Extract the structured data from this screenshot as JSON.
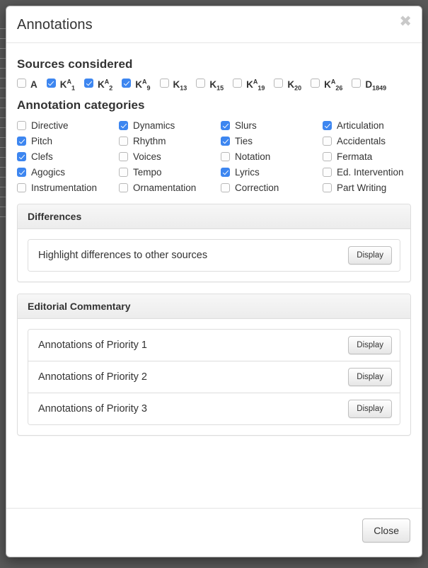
{
  "modal": {
    "title": "Annotations",
    "close_icon": "✖",
    "footer": {
      "close_label": "Close"
    }
  },
  "sources": {
    "heading": "Sources considered",
    "items": [
      {
        "base": "A",
        "sup": "",
        "sub": "",
        "checked": false
      },
      {
        "base": "K",
        "sup": "A",
        "sub": "1",
        "checked": true
      },
      {
        "base": "K",
        "sup": "A",
        "sub": "2",
        "checked": true
      },
      {
        "base": "K",
        "sup": "A",
        "sub": "9",
        "checked": true
      },
      {
        "base": "K",
        "sup": "",
        "sub": "13",
        "checked": false
      },
      {
        "base": "K",
        "sup": "",
        "sub": "15",
        "checked": false
      },
      {
        "base": "K",
        "sup": "A",
        "sub": "19",
        "checked": false
      },
      {
        "base": "K",
        "sup": "",
        "sub": "20",
        "checked": false
      },
      {
        "base": "K",
        "sup": "A",
        "sub": "26",
        "checked": false
      },
      {
        "base": "D",
        "sup": "",
        "sub": "1849",
        "checked": false
      }
    ]
  },
  "categories": {
    "heading": "Annotation categories",
    "items": [
      {
        "label": "Directive",
        "checked": false
      },
      {
        "label": "Dynamics",
        "checked": true
      },
      {
        "label": "Slurs",
        "checked": true
      },
      {
        "label": "Articulation",
        "checked": true
      },
      {
        "label": "Pitch",
        "checked": true
      },
      {
        "label": "Rhythm",
        "checked": false
      },
      {
        "label": "Ties",
        "checked": true
      },
      {
        "label": "Accidentals",
        "checked": false
      },
      {
        "label": "Clefs",
        "checked": true
      },
      {
        "label": "Voices",
        "checked": false
      },
      {
        "label": "Notation",
        "checked": false
      },
      {
        "label": "Fermata",
        "checked": false
      },
      {
        "label": "Agogics",
        "checked": true
      },
      {
        "label": "Tempo",
        "checked": false
      },
      {
        "label": "Lyrics",
        "checked": true
      },
      {
        "label": "Ed. Intervention",
        "checked": false
      },
      {
        "label": "Instrumentation",
        "checked": false
      },
      {
        "label": "Ornamentation",
        "checked": false
      },
      {
        "label": "Correction",
        "checked": false
      },
      {
        "label": "Part Writing",
        "checked": false
      }
    ]
  },
  "differences": {
    "heading": "Differences",
    "rows": [
      {
        "label": "Highlight differences to other sources",
        "button": "Display"
      }
    ]
  },
  "editorial": {
    "heading": "Editorial Commentary",
    "rows": [
      {
        "label": "Annotations of Priority 1",
        "button": "Display"
      },
      {
        "label": "Annotations of Priority 2",
        "button": "Display"
      },
      {
        "label": "Annotations of Priority 3",
        "button": "Display"
      }
    ]
  },
  "theme": {
    "accent": "#3d86f0",
    "text": "#333333",
    "panel_border": "#dddddd",
    "backdrop": "#595959"
  }
}
